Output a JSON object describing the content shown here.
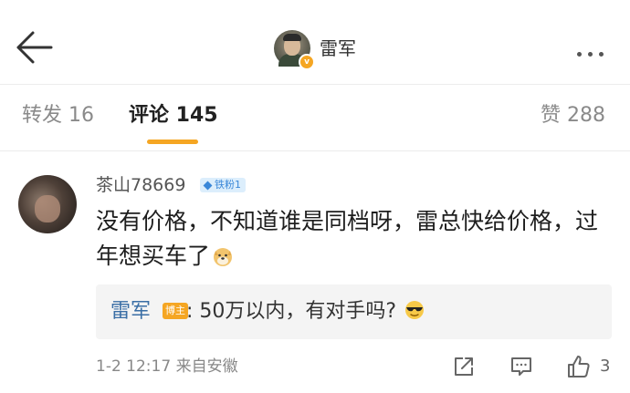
{
  "header": {
    "title": "雷军",
    "verify_mark": "v"
  },
  "tabs": [
    {
      "label": "转发 16"
    },
    {
      "label": "评论 145"
    },
    {
      "label": "赞 288"
    }
  ],
  "comment": {
    "user": "茶山78669",
    "fan_badge": "铁粉1",
    "text": "没有价格，不知道谁是同档呀，雷总快给价格，过年想买车了",
    "text_emoji": "doge-emoji",
    "reply": {
      "user": "雷军",
      "badge": "博主",
      "text": ": 50万以内，有对手吗?",
      "emoji": "cool-sunglasses-emoji"
    },
    "meta": "1-2 12:17 来自安徽",
    "like_count": "3"
  },
  "colors": {
    "accent": "#f5a623",
    "link": "#3a6ea5",
    "fan_badge_bg": "#dceefc"
  },
  "icons": [
    "back-arrow-icon",
    "more-icon",
    "share-icon",
    "comment-icon",
    "like-icon"
  ]
}
